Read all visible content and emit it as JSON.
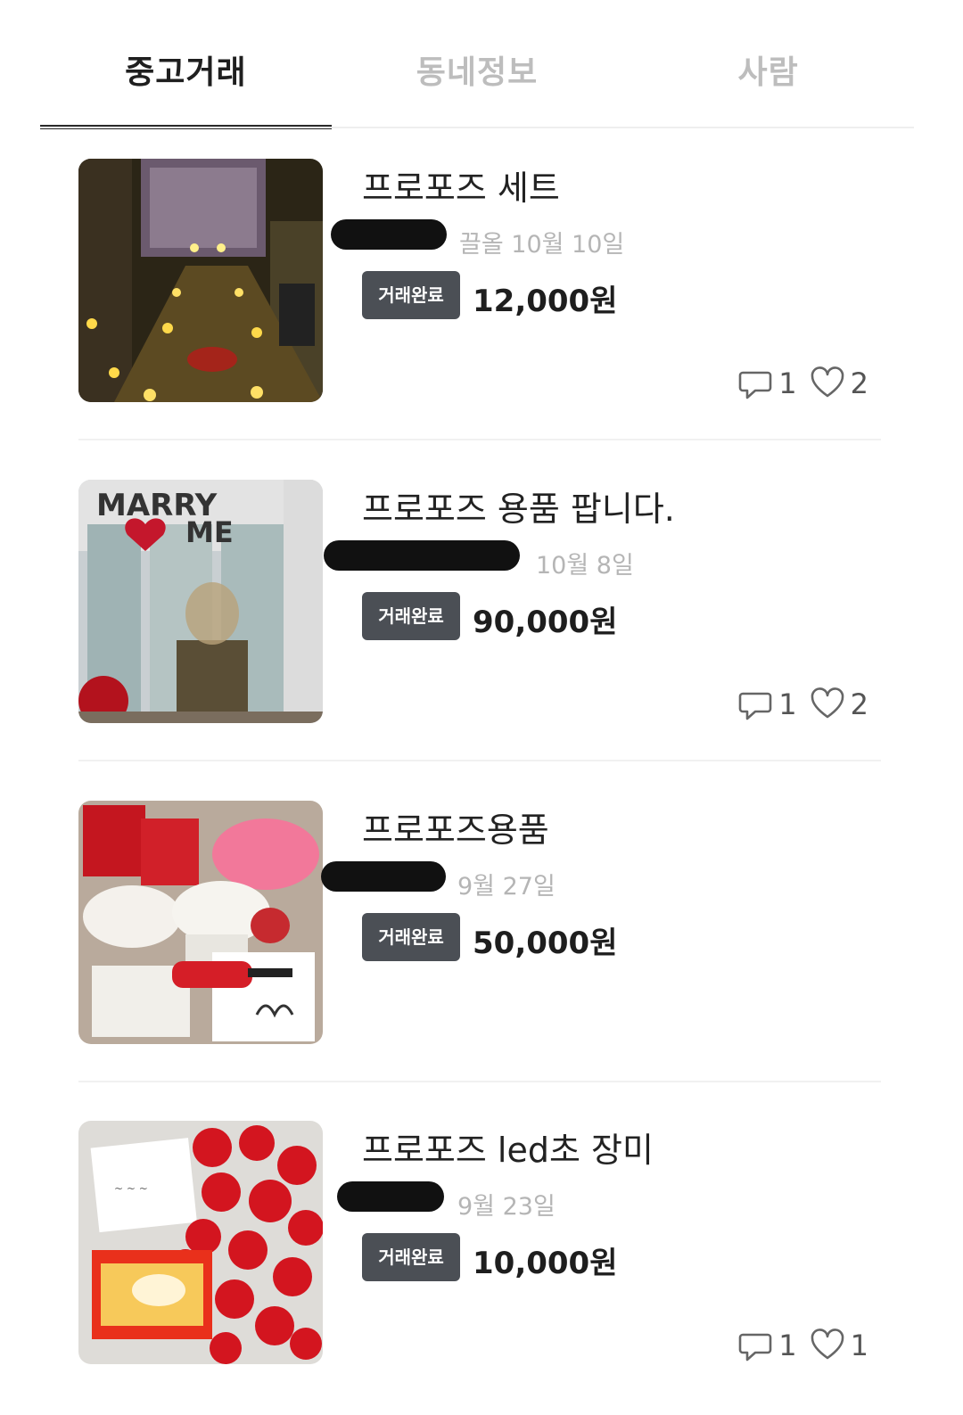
{
  "tabs": [
    {
      "label": "중고거래",
      "active": true
    },
    {
      "label": "동네정보",
      "active": false
    },
    {
      "label": "사람",
      "active": false
    }
  ],
  "items": [
    {
      "title": "프로포즈 세트",
      "meta": "끌올 10월 10일",
      "status": "거래완료",
      "price": "12,000원",
      "comments": "1",
      "likes": "2"
    },
    {
      "title": "프로포즈 용품 팝니다.",
      "meta": "10월 8일",
      "status": "거래완료",
      "price": "90,000원",
      "comments": "1",
      "likes": "2"
    },
    {
      "title": "프로포즈용품",
      "meta": "9월 27일",
      "status": "거래완료",
      "price": "50,000원"
    },
    {
      "title": "프로포즈 led초 장미",
      "meta": "9월 23일",
      "status": "거래완료",
      "price": "10,000원",
      "comments": "1",
      "likes": "1"
    }
  ],
  "icons": {
    "comment": "speech-bubble-icon",
    "like": "heart-icon"
  },
  "colors": {
    "badge": "#4b4f55",
    "active_tab": "#1f1f1f",
    "inactive_tab": "#bdbdbd"
  }
}
